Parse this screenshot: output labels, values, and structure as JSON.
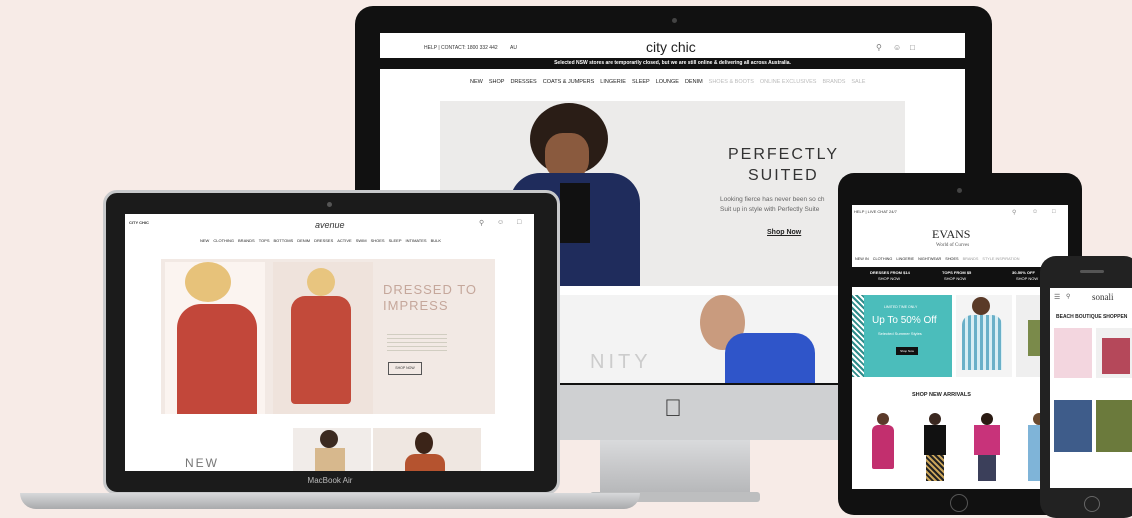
{
  "imac": {
    "topbar": {
      "help": "HELP | CONTACT: 1800 332 442",
      "region": "AU",
      "logo": "city chic"
    },
    "banner": "Selected NSW stores are temporarily closed, but we are still online & delivering all across Australia.",
    "nav": [
      "NEW",
      "SHOP",
      "DRESSES",
      "COATS & JUMPERS",
      "LINGERIE",
      "SLEEP",
      "LOUNGE",
      "DENIM",
      "SHOES & BOOTS",
      "ONLINE EXCLUSIVES",
      "BRANDS",
      "SALE"
    ],
    "hero": {
      "title_line1": "PERFECTLY",
      "title_line2": "SUITED",
      "body_line1": "Looking fierce has never been so ch",
      "body_line2": "Suit up in style with Perfectly Suite",
      "cta": "Shop Now"
    },
    "lower_text": "NITY"
  },
  "laptop": {
    "brands": [
      "CITY CHIC",
      "avenue"
    ],
    "nav": [
      "NEW",
      "CLOTHING",
      "BRANDS",
      "TOPS",
      "BOTTOMS",
      "DENIM",
      "DRESSES",
      "ACTIVE",
      "SWIM",
      "SHOES",
      "SLEEP",
      "INTIMATES",
      "BULK"
    ],
    "hero": {
      "title_line1": "DRESSED TO",
      "title_line2": "IMPRESS",
      "cta": "SHOP NOW"
    },
    "lower_text": "NEW",
    "model": "MacBook Air"
  },
  "tablet": {
    "help": "HELP | LIVE CHAT 24/7",
    "logo": "EVANS",
    "tagline": "World of Curves",
    "nav": [
      "NEW IN",
      "CLOTHING",
      "LINGERIE",
      "NIGHTWEAR",
      "SHOES",
      "BRANDS",
      "STYLE INSPIRATION"
    ],
    "promos": [
      {
        "line1": "DRESSES FROM $14",
        "line2": "SHOP NOW"
      },
      {
        "line1": "TOPS FROM $5",
        "line2": "SHOP NOW"
      },
      {
        "line1": "30-50% OFF",
        "line2": "SHOP NOW"
      }
    ],
    "sale": {
      "kicker": "LIMITED TIME ONLY",
      "title": "Up To 50% Off",
      "sub": "Selected Summer Styles",
      "cta": "Shop Now"
    },
    "section": "SHOP NEW ARRIVALS"
  },
  "phone": {
    "logo": "sonali",
    "heading": "BEACH BOUTIQUE SHOPPEN"
  },
  "colors": {
    "background": "#f7ebe7",
    "device": "#111111",
    "teal": "#4bbdbb",
    "hero_bg": "#f0e6e2"
  }
}
